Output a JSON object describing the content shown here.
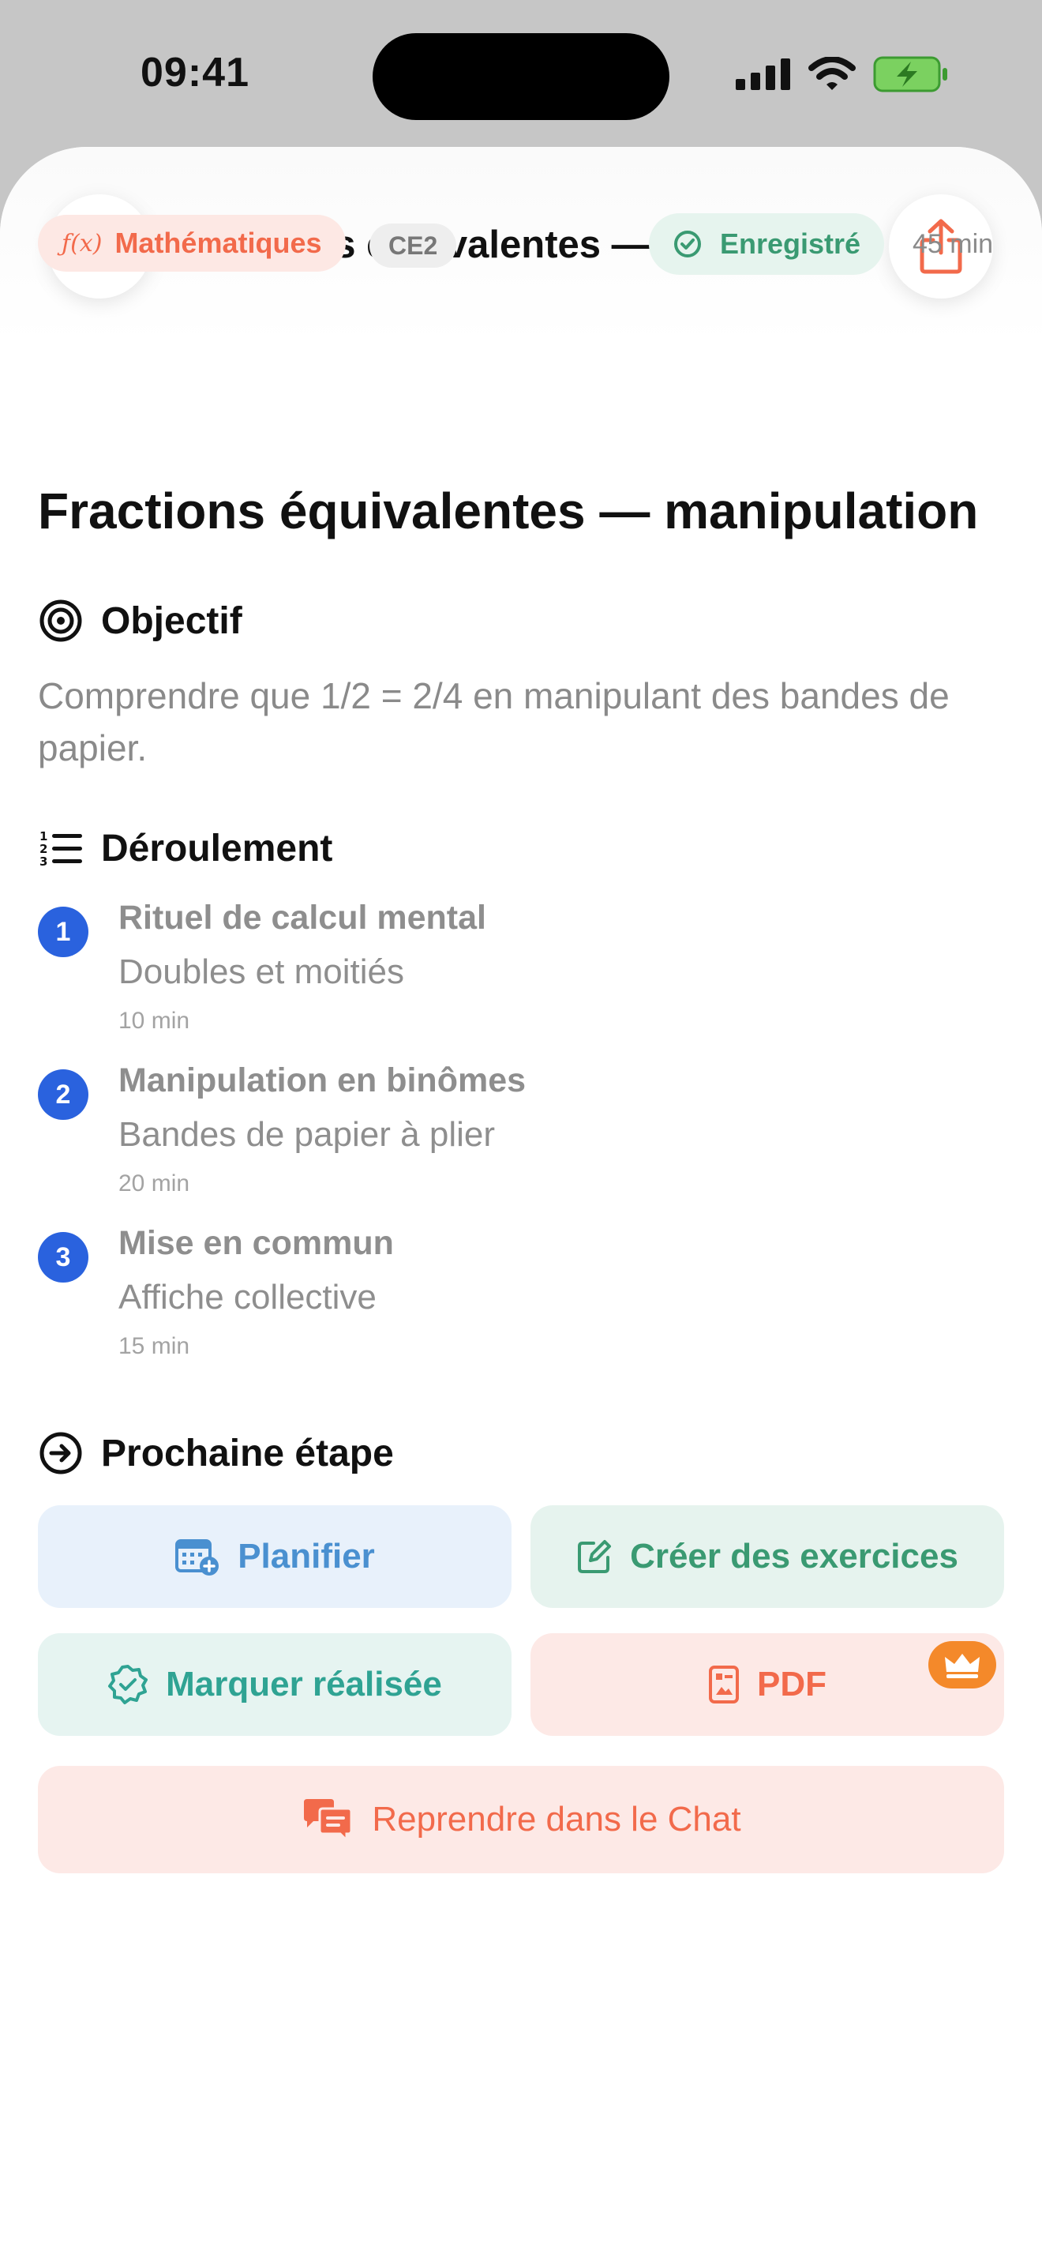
{
  "status": {
    "time": "09:41"
  },
  "nav": {
    "title": "Fractions équivalentes — manipulation"
  },
  "meta": {
    "subject": "Mathématiques",
    "level": "CE2",
    "saved": "Enregistré",
    "duration": "45 min"
  },
  "lesson": {
    "title": "Fractions équivalentes — manipulation",
    "objective_heading": "Objectif",
    "objective": "Comprendre que 1/2 = 2/4 en manipulant des bandes de papier.",
    "steps_heading": "Déroulement",
    "steps": [
      {
        "num": "1",
        "title": "Rituel de calcul mental",
        "desc": "Doubles et moitiés",
        "time": "10 min"
      },
      {
        "num": "2",
        "title": "Manipulation en binômes",
        "desc": "Bandes de papier à plier",
        "time": "20 min"
      },
      {
        "num": "3",
        "title": "Mise en commun",
        "desc": "Affiche collective",
        "time": "15 min"
      }
    ]
  },
  "next": {
    "heading": "Prochaine étape",
    "plan": "Planifier",
    "exercises": "Créer des exercices",
    "mark_done": "Marquer réalisée",
    "pdf": "PDF",
    "chat": "Reprendre dans le Chat"
  },
  "colors": {
    "accent": "#f26a4b",
    "step_badge": "#2a62de",
    "saved_green": "#3a9a72",
    "plan_blue": "#4a90d0",
    "premium_orange": "#f4892a"
  },
  "icons": [
    "back-chevron-icon",
    "share-icon",
    "fx-icon",
    "check-circle-icon",
    "target-icon",
    "numbered-list-icon",
    "arrow-right-circle-icon",
    "calendar-add-icon",
    "edit-icon",
    "verified-badge-icon",
    "pdf-file-icon",
    "crown-icon",
    "chat-bubbles-icon"
  ]
}
